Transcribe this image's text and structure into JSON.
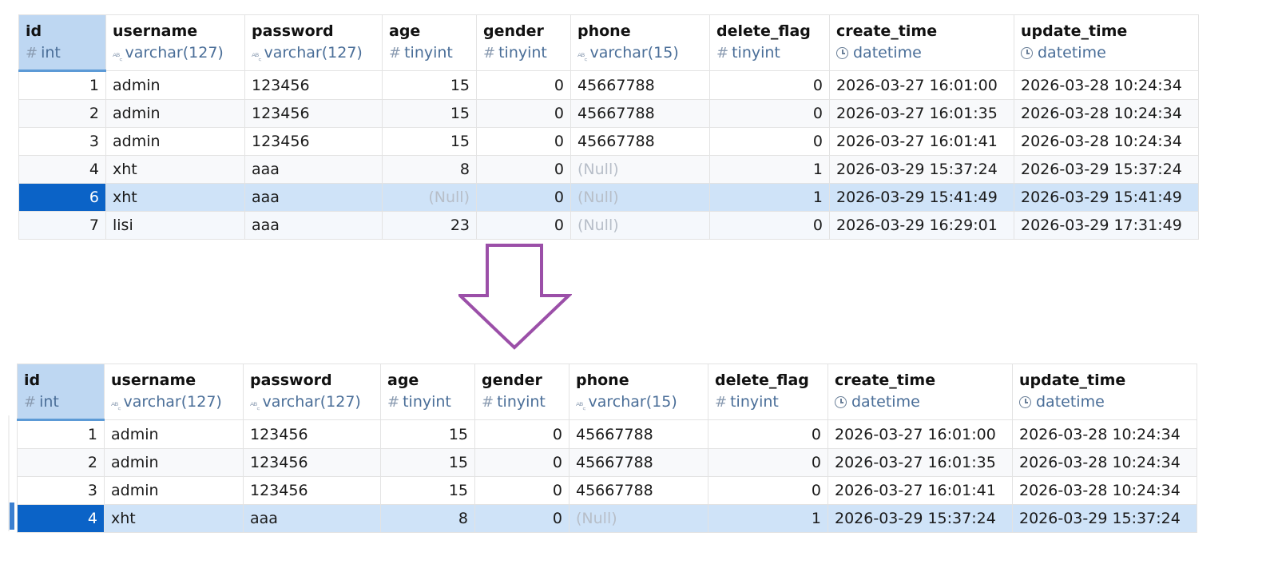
{
  "columns": [
    {
      "name": "id",
      "type": "int",
      "icon": "hash-icon"
    },
    {
      "name": "username",
      "type": "varchar(127)",
      "icon": "abc-icon"
    },
    {
      "name": "password",
      "type": "varchar(127)",
      "icon": "abc-icon"
    },
    {
      "name": "age",
      "type": "tinyint",
      "icon": "hash-icon"
    },
    {
      "name": "gender",
      "type": "tinyint",
      "icon": "hash-icon"
    },
    {
      "name": "phone",
      "type": "varchar(15)",
      "icon": "abc-icon"
    },
    {
      "name": "delete_flag",
      "type": "tinyint",
      "icon": "hash-icon"
    },
    {
      "name": "create_time",
      "type": "datetime",
      "icon": "clock-icon"
    },
    {
      "name": "update_time",
      "type": "datetime",
      "icon": "clock-icon"
    }
  ],
  "icons": {
    "hash": "#",
    "abc": "ᴬᴮ꜀"
  },
  "colors": {
    "selected_row": "#cfe3f8",
    "selected_id": "#0b63c7",
    "arrow": "#9b4fa8",
    "type_text": "#4a6e98",
    "null_text": "#b7bec8"
  },
  "before_rows": [
    {
      "id": "1",
      "username": "admin",
      "password": "123456",
      "age": "15",
      "gender": "0",
      "phone": "45667788",
      "delete_flag": "0",
      "create_time": "2026-03-27 16:01:00",
      "update_time": "2026-03-28 10:24:34"
    },
    {
      "id": "2",
      "username": "admin",
      "password": "123456",
      "age": "15",
      "gender": "0",
      "phone": "45667788",
      "delete_flag": "0",
      "create_time": "2026-03-27 16:01:35",
      "update_time": "2026-03-28 10:24:34"
    },
    {
      "id": "3",
      "username": "admin",
      "password": "123456",
      "age": "15",
      "gender": "0",
      "phone": "45667788",
      "delete_flag": "0",
      "create_time": "2026-03-27 16:01:41",
      "update_time": "2026-03-28 10:24:34"
    },
    {
      "id": "4",
      "username": "xht",
      "password": "aaa",
      "age": "8",
      "gender": "0",
      "phone": "(Null)",
      "delete_flag": "1",
      "create_time": "2026-03-29 15:37:24",
      "update_time": "2026-03-29 15:37:24"
    },
    {
      "id": "6",
      "username": "xht",
      "password": "aaa",
      "age": "(Null)",
      "gender": "0",
      "phone": "(Null)",
      "delete_flag": "1",
      "create_time": "2026-03-29 15:41:49",
      "update_time": "2026-03-29 15:41:49"
    },
    {
      "id": "7",
      "username": "lisi",
      "password": "aaa",
      "age": "23",
      "gender": "0",
      "phone": "(Null)",
      "delete_flag": "0",
      "create_time": "2026-03-29 16:29:01",
      "update_time": "2026-03-29 17:31:49"
    }
  ],
  "after_rows": [
    {
      "id": "1",
      "username": "admin",
      "password": "123456",
      "age": "15",
      "gender": "0",
      "phone": "45667788",
      "delete_flag": "0",
      "create_time": "2026-03-27 16:01:00",
      "update_time": "2026-03-28 10:24:34"
    },
    {
      "id": "2",
      "username": "admin",
      "password": "123456",
      "age": "15",
      "gender": "0",
      "phone": "45667788",
      "delete_flag": "0",
      "create_time": "2026-03-27 16:01:35",
      "update_time": "2026-03-28 10:24:34"
    },
    {
      "id": "3",
      "username": "admin",
      "password": "123456",
      "age": "15",
      "gender": "0",
      "phone": "45667788",
      "delete_flag": "0",
      "create_time": "2026-03-27 16:01:41",
      "update_time": "2026-03-28 10:24:34"
    },
    {
      "id": "4",
      "username": "xht",
      "password": "aaa",
      "age": "8",
      "gender": "0",
      "phone": "(Null)",
      "delete_flag": "1",
      "create_time": "2026-03-29 15:37:24",
      "update_time": "2026-03-29 15:37:24"
    }
  ]
}
